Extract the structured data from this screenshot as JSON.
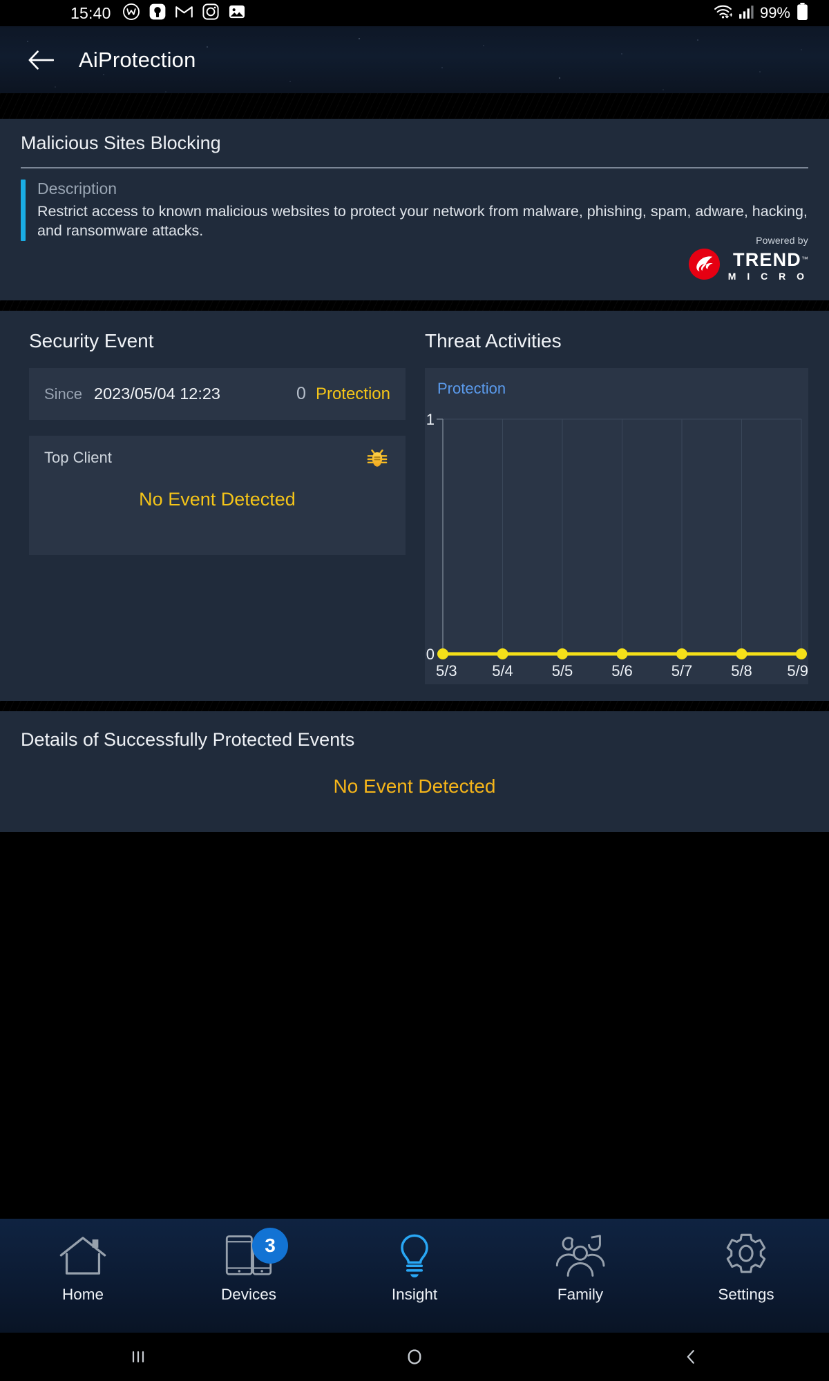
{
  "statusbar": {
    "time": "15:40",
    "icons": [
      "w-app-icon",
      "messenger-icon",
      "gmail-icon",
      "instagram-icon",
      "photos-icon"
    ],
    "wifi_icon": "wifi-icon",
    "signal_icon": "cellular-signal-icon",
    "battery_text": "99%",
    "battery_icon": "battery-full-icon"
  },
  "appbar": {
    "back_icon": "back-arrow-icon",
    "title": "AiProtection"
  },
  "malicious": {
    "title": "Malicious Sites Blocking",
    "description_label": "Description",
    "description_text": "Restrict access to known malicious websites to protect your network from malware, phishing, spam, adware, hacking, and ransomware attacks.",
    "powered_by": "Powered by",
    "brand_main": "TREND",
    "brand_sub": "M I C R O",
    "brand_tm": "™",
    "accent_color": "#1aade4",
    "brand_color": "#e60012"
  },
  "security_event": {
    "heading": "Security Event",
    "since_label": "Since",
    "since_value": "2023/05/04 12:23",
    "protection_count": "0",
    "protection_label": "Protection",
    "top_client_label": "Top Client",
    "bug_icon": "bug-icon",
    "no_event_text": "No Event Detected",
    "accent_color": "#f5c518"
  },
  "threat_activities": {
    "heading": "Threat Activities",
    "legend": "Protection"
  },
  "chart_data": {
    "type": "line",
    "title": "Threat Activities",
    "legend": [
      "Protection"
    ],
    "legend_position": "top-left",
    "categories": [
      "5/3",
      "5/4",
      "5/5",
      "5/6",
      "5/7",
      "5/8",
      "5/9"
    ],
    "series": [
      {
        "name": "Protection",
        "values": [
          0,
          0,
          0,
          0,
          0,
          0,
          0
        ],
        "color": "#f5e019"
      }
    ],
    "xlabel": "",
    "ylabel": "",
    "ylim": [
      0,
      1
    ],
    "yticks": [
      "0",
      "1"
    ],
    "grid": true
  },
  "details": {
    "title": "Details of Successfully Protected Events",
    "message": "No Event Detected"
  },
  "bottomnav": {
    "items": [
      {
        "label": "Home",
        "icon": "home-icon",
        "badge": null,
        "active": false
      },
      {
        "label": "Devices",
        "icon": "devices-icon",
        "badge": "3",
        "active": false
      },
      {
        "label": "Insight",
        "icon": "bulb-icon",
        "badge": null,
        "active": true
      },
      {
        "label": "Family",
        "icon": "family-icon",
        "badge": null,
        "active": false
      },
      {
        "label": "Settings",
        "icon": "gear-icon",
        "badge": null,
        "active": false
      }
    ],
    "active_color": "#29a7f5",
    "badge_color": "#1273d4"
  },
  "sysnav": {
    "recents_icon": "recents-icon",
    "home_icon": "home-circle-icon",
    "back_icon": "back-chevron-icon"
  }
}
